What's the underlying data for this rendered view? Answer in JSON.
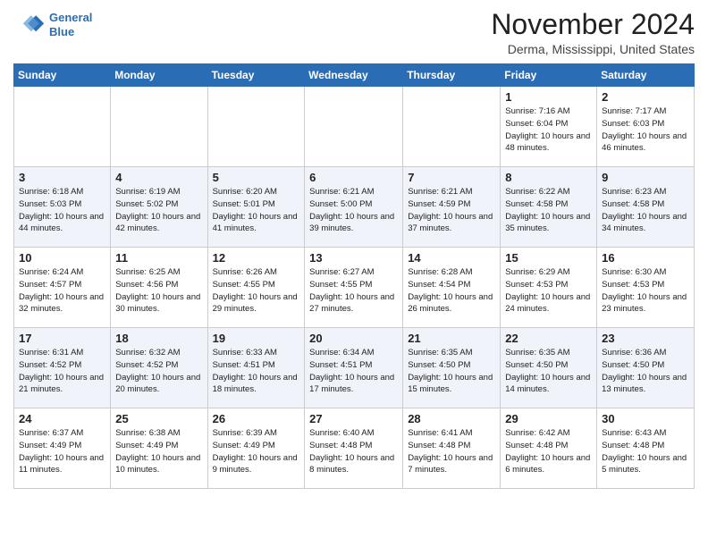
{
  "header": {
    "logo_line1": "General",
    "logo_line2": "Blue",
    "month": "November 2024",
    "location": "Derma, Mississippi, United States"
  },
  "weekdays": [
    "Sunday",
    "Monday",
    "Tuesday",
    "Wednesday",
    "Thursday",
    "Friday",
    "Saturday"
  ],
  "rows": [
    {
      "cells": [
        {
          "empty": true
        },
        {
          "empty": true
        },
        {
          "empty": true
        },
        {
          "empty": true
        },
        {
          "empty": true
        },
        {
          "day": 1,
          "sunrise": "7:16 AM",
          "sunset": "6:04 PM",
          "daylight": "10 hours and 48 minutes."
        },
        {
          "day": 2,
          "sunrise": "7:17 AM",
          "sunset": "6:03 PM",
          "daylight": "10 hours and 46 minutes."
        }
      ]
    },
    {
      "cells": [
        {
          "day": 3,
          "sunrise": "6:18 AM",
          "sunset": "5:03 PM",
          "daylight": "10 hours and 44 minutes."
        },
        {
          "day": 4,
          "sunrise": "6:19 AM",
          "sunset": "5:02 PM",
          "daylight": "10 hours and 42 minutes."
        },
        {
          "day": 5,
          "sunrise": "6:20 AM",
          "sunset": "5:01 PM",
          "daylight": "10 hours and 41 minutes."
        },
        {
          "day": 6,
          "sunrise": "6:21 AM",
          "sunset": "5:00 PM",
          "daylight": "10 hours and 39 minutes."
        },
        {
          "day": 7,
          "sunrise": "6:21 AM",
          "sunset": "4:59 PM",
          "daylight": "10 hours and 37 minutes."
        },
        {
          "day": 8,
          "sunrise": "6:22 AM",
          "sunset": "4:58 PM",
          "daylight": "10 hours and 35 minutes."
        },
        {
          "day": 9,
          "sunrise": "6:23 AM",
          "sunset": "4:58 PM",
          "daylight": "10 hours and 34 minutes."
        }
      ]
    },
    {
      "cells": [
        {
          "day": 10,
          "sunrise": "6:24 AM",
          "sunset": "4:57 PM",
          "daylight": "10 hours and 32 minutes."
        },
        {
          "day": 11,
          "sunrise": "6:25 AM",
          "sunset": "4:56 PM",
          "daylight": "10 hours and 30 minutes."
        },
        {
          "day": 12,
          "sunrise": "6:26 AM",
          "sunset": "4:55 PM",
          "daylight": "10 hours and 29 minutes."
        },
        {
          "day": 13,
          "sunrise": "6:27 AM",
          "sunset": "4:55 PM",
          "daylight": "10 hours and 27 minutes."
        },
        {
          "day": 14,
          "sunrise": "6:28 AM",
          "sunset": "4:54 PM",
          "daylight": "10 hours and 26 minutes."
        },
        {
          "day": 15,
          "sunrise": "6:29 AM",
          "sunset": "4:53 PM",
          "daylight": "10 hours and 24 minutes."
        },
        {
          "day": 16,
          "sunrise": "6:30 AM",
          "sunset": "4:53 PM",
          "daylight": "10 hours and 23 minutes."
        }
      ]
    },
    {
      "cells": [
        {
          "day": 17,
          "sunrise": "6:31 AM",
          "sunset": "4:52 PM",
          "daylight": "10 hours and 21 minutes."
        },
        {
          "day": 18,
          "sunrise": "6:32 AM",
          "sunset": "4:52 PM",
          "daylight": "10 hours and 20 minutes."
        },
        {
          "day": 19,
          "sunrise": "6:33 AM",
          "sunset": "4:51 PM",
          "daylight": "10 hours and 18 minutes."
        },
        {
          "day": 20,
          "sunrise": "6:34 AM",
          "sunset": "4:51 PM",
          "daylight": "10 hours and 17 minutes."
        },
        {
          "day": 21,
          "sunrise": "6:35 AM",
          "sunset": "4:50 PM",
          "daylight": "10 hours and 15 minutes."
        },
        {
          "day": 22,
          "sunrise": "6:35 AM",
          "sunset": "4:50 PM",
          "daylight": "10 hours and 14 minutes."
        },
        {
          "day": 23,
          "sunrise": "6:36 AM",
          "sunset": "4:50 PM",
          "daylight": "10 hours and 13 minutes."
        }
      ]
    },
    {
      "cells": [
        {
          "day": 24,
          "sunrise": "6:37 AM",
          "sunset": "4:49 PM",
          "daylight": "10 hours and 11 minutes."
        },
        {
          "day": 25,
          "sunrise": "6:38 AM",
          "sunset": "4:49 PM",
          "daylight": "10 hours and 10 minutes."
        },
        {
          "day": 26,
          "sunrise": "6:39 AM",
          "sunset": "4:49 PM",
          "daylight": "10 hours and 9 minutes."
        },
        {
          "day": 27,
          "sunrise": "6:40 AM",
          "sunset": "4:48 PM",
          "daylight": "10 hours and 8 minutes."
        },
        {
          "day": 28,
          "sunrise": "6:41 AM",
          "sunset": "4:48 PM",
          "daylight": "10 hours and 7 minutes."
        },
        {
          "day": 29,
          "sunrise": "6:42 AM",
          "sunset": "4:48 PM",
          "daylight": "10 hours and 6 minutes."
        },
        {
          "day": 30,
          "sunrise": "6:43 AM",
          "sunset": "4:48 PM",
          "daylight": "10 hours and 5 minutes."
        }
      ]
    }
  ]
}
